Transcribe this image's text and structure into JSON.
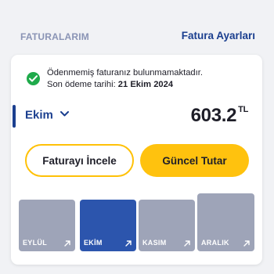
{
  "header": {
    "section_title": "FATURALARIM",
    "settings_link": "Fatura Ayarları"
  },
  "notice": {
    "icon": "check-circle-icon",
    "line1": "Ödenmemiş faturanız bulunmamaktadır.",
    "line2_prefix": "Son ödeme tarihi: ",
    "line2_date": "21 Ekim 2024"
  },
  "bill": {
    "selected_month": "Ekim",
    "amount": "603.2",
    "currency": "TL"
  },
  "actions": {
    "review_label": "Faturayı İncele",
    "current_amount_label": "Güncel Tutar"
  },
  "months": [
    {
      "label": "EYLÜL",
      "active": false
    },
    {
      "label": "EKİM",
      "active": true
    },
    {
      "label": "KASIM",
      "active": false
    },
    {
      "label": "ARALIK",
      "active": false
    }
  ],
  "colors": {
    "brand_blue": "#1b3f8f",
    "accent_yellow": "#ffc20e",
    "success_green": "#1faa4b",
    "tile_active": "#2c55ad",
    "tile_inactive": "#9ea4b8"
  }
}
